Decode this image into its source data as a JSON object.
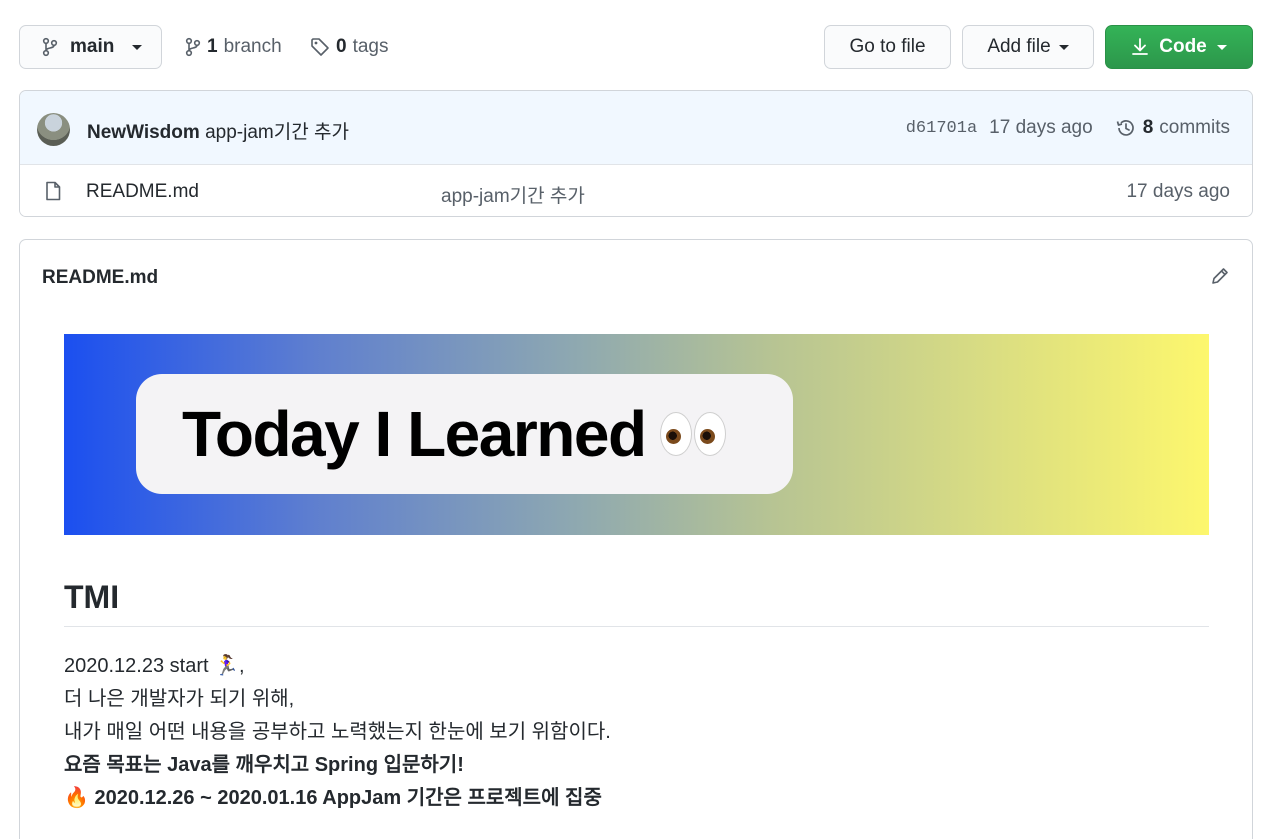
{
  "toolbar": {
    "branch_name": "main",
    "branch_count": "1",
    "branch_label": "branch",
    "tag_count": "0",
    "tag_label": "tags",
    "go_to_file": "Go to file",
    "add_file": "Add file",
    "code": "Code"
  },
  "commit": {
    "author": "NewWisdom",
    "message": "app-jam기간 추가",
    "sha": "d61701a",
    "age": "17 days ago",
    "commit_count": "8",
    "commit_label": "commits"
  },
  "files": [
    {
      "name": "README.md",
      "message": "app-jam기간 추가",
      "age": "17 days ago"
    }
  ],
  "readme": {
    "title": "README.md",
    "banner_text": "Today I Learned",
    "heading": "TMI",
    "line1": "2020.12.23 start 🏃‍♀️,",
    "line2": "더 나은 개발자가 되기 위해,",
    "line3": "내가 매일 어떤 내용을 공부하고 노력했는지 한눈에 보기 위함이다.",
    "line4": "요즘 목표는 Java를 깨우치고 Spring 입문하기!",
    "line5": "🔥 2020.12.26 ~ 2020.01.16 AppJam 기간은 프로젝트에 집중"
  },
  "colors": {
    "code_button": "#2ea44f",
    "commit_header_bg": "#f1f8ff",
    "banner_start": "#1b4ff0",
    "banner_end": "#fdf76d"
  }
}
